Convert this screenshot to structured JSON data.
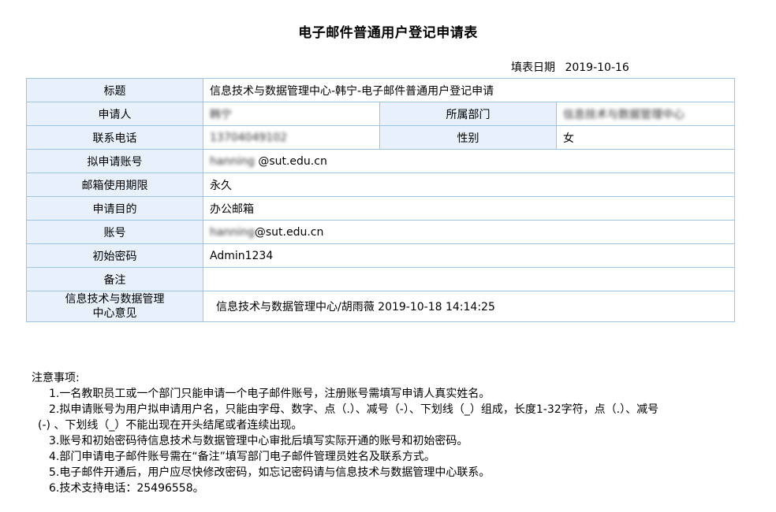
{
  "form": {
    "title": "电子邮件普通用户登记申请表",
    "date_label": "填表日期",
    "date_value": "2019-10-16",
    "rows": {
      "subject": {
        "label": "标题",
        "value": "信息技术与数据管理中心-韩宁-电子邮件普通用户登记申请"
      },
      "applicant": {
        "label": "申请人",
        "value": "韩宁"
      },
      "department": {
        "label": "所属部门",
        "value": "信息技术与数据管理中心"
      },
      "phone": {
        "label": "联系电话",
        "value": "13704049102"
      },
      "gender": {
        "label": "性别",
        "value": "女"
      },
      "proposed_account": {
        "label": "拟申请账号",
        "value_blurred": "hanning",
        "value_domain": "@sut.edu.cn"
      },
      "period": {
        "label": "邮箱使用期限",
        "value": "永久"
      },
      "purpose": {
        "label": "申请目的",
        "value": "办公邮箱"
      },
      "account": {
        "label": "账号",
        "value_blurred": "hanning",
        "value_domain": "@sut.edu.cn"
      },
      "initial_password": {
        "label": "初始密码",
        "value": "Admin1234"
      },
      "remarks": {
        "label": "备注",
        "value": ""
      },
      "center_opinion": {
        "label_line1": "信息技术与数据管理",
        "label_line2": "中心意见",
        "value": "信息技术与数据管理中心/胡雨薇 2019-10-18 14:14:25"
      }
    }
  },
  "notes": {
    "heading": "注意事项:",
    "items": [
      "1.一名教职员工或一个部门只能申请一个电子邮件账号，注册账号需填写申请人真实姓名。",
      "2.拟申请账号为用户拟申请用户名，只能由字母、数字、点（.）、减号（-）、下划线（_）组成，长度1-32字符，点（.）、减号",
      "3.账号和初始密码待信息技术与数据管理中心审批后填写实际开通的账号和初始密码。",
      "4.部门申请电子邮件账号需在“备注”填写部门电子邮件管理员姓名及联系方式。",
      "5.电子邮件开通后，用户应尽快修改密码，如忘记密码请与信息技术与数据管理中心联系。",
      "6.技术支持电话：25496558。"
    ],
    "item2_continuation": "(-) 、下划线（_）不能出现在开头结尾或者连续出现。"
  },
  "colors": {
    "border": "#9cc4e4",
    "label_bg": "#e8f1fb"
  }
}
